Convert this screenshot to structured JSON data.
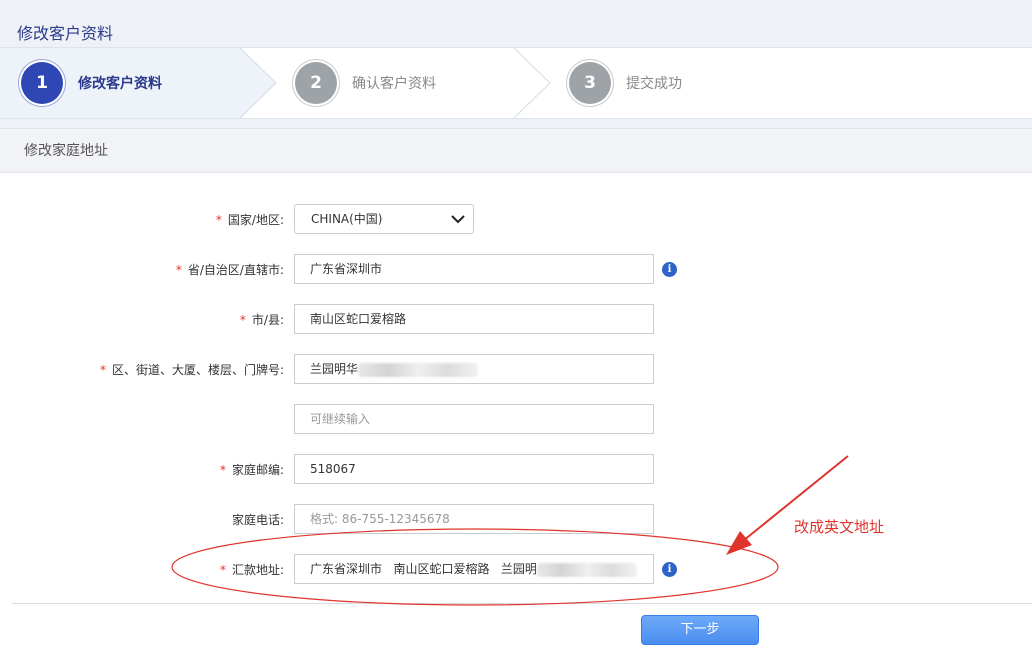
{
  "page_title": "修改客户资料",
  "steps": [
    {
      "number": "1",
      "label": "修改客户资料"
    },
    {
      "number": "2",
      "label": "确认客户资料"
    },
    {
      "number": "3",
      "label": "提交成功"
    }
  ],
  "section_title": "修改家庭地址",
  "form": {
    "country": {
      "label": "国家/地区:",
      "value": "CHINA(中国)"
    },
    "province": {
      "label": "省/自治区/直辖市:",
      "value": "广东省深圳市"
    },
    "city": {
      "label": "市/县:",
      "value": "南山区蛇口爱榕路"
    },
    "district": {
      "label": "区、街道、大厦、楼层、门牌号:",
      "value": "兰园明华"
    },
    "district_more": {
      "placeholder": "可继续输入"
    },
    "postal_code": {
      "label": "家庭邮编:",
      "value": "518067"
    },
    "phone": {
      "label": "家庭电话:",
      "placeholder": "格式: 86-755-12345678"
    },
    "remit_address": {
      "label": "汇款地址:",
      "value": "广东省深圳市   南山区蛇口爱榕路   兰园明"
    }
  },
  "next_button": "下一步",
  "annotation": "改成英文地址",
  "required_mark": "*",
  "info_glyph": "i",
  "colors": {
    "accent": "#2f47b5",
    "required": "#e0342c",
    "annotation": "#e0342c",
    "button": "#4a8ef0"
  }
}
